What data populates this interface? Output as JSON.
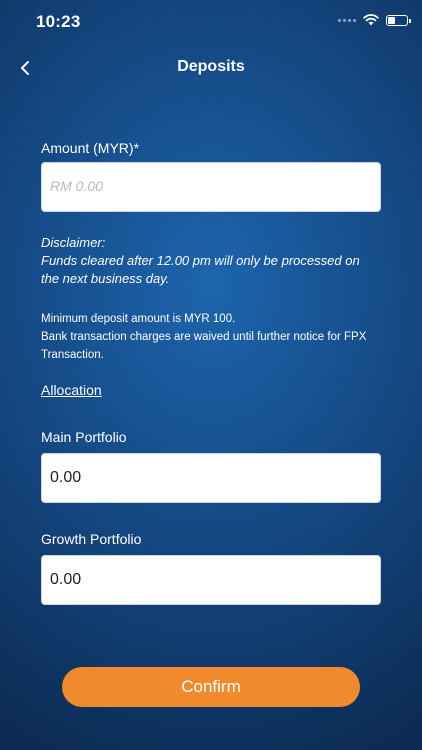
{
  "status_bar": {
    "time": "10:23"
  },
  "header": {
    "title": "Deposits",
    "back_icon": "chevron-left-icon"
  },
  "amount": {
    "label": "Amount (MYR)*",
    "placeholder": "RM 0.00",
    "value": ""
  },
  "disclaimer": {
    "heading": "Disclaimer:",
    "text": "Funds cleared after 12.00 pm will only be processed on the next business day."
  },
  "notes": {
    "line1": "Minimum deposit amount is MYR 100.",
    "line2": "Bank transaction charges are waived until further notice for FPX Transaction."
  },
  "allocation": {
    "link_label": "Allocation",
    "main": {
      "label": "Main Portfolio",
      "value": "0.00"
    },
    "growth": {
      "label": "Growth Portfolio",
      "value": "0.00"
    }
  },
  "confirm_button": {
    "label": "Confirm",
    "color": "#f08a2c"
  },
  "colors": {
    "background_center": "#1d65ad",
    "background_edge": "#0c2a52"
  }
}
